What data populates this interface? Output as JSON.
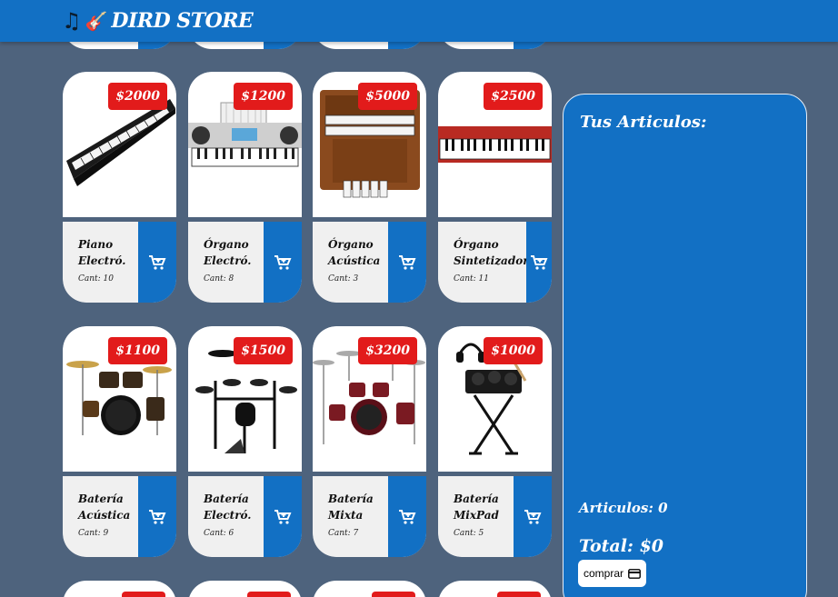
{
  "header": {
    "icon_note": "♫",
    "icon_guitar": "🎸",
    "title": "DIRD STORE"
  },
  "products": [
    {
      "price": "$2000",
      "name": "Piano Electró.",
      "qty": "Cant: 10",
      "image": "digital-piano"
    },
    {
      "price": "$1200",
      "name": "Órgano Electró.",
      "qty": "Cant: 8",
      "image": "electronic-keyboard"
    },
    {
      "price": "$5000",
      "name": "Órgano Acústica",
      "qty": "Cant: 3",
      "image": "wooden-organ"
    },
    {
      "price": "$2500",
      "name": "Órgano Sintetizador",
      "qty": "Cant: 11",
      "image": "red-synthesizer"
    },
    {
      "price": "$1100",
      "name": "Batería Acústica",
      "qty": "Cant: 9",
      "image": "acoustic-drum-kit"
    },
    {
      "price": "$1500",
      "name": "Batería Electró.",
      "qty": "Cant: 6",
      "image": "electronic-drum-kit"
    },
    {
      "price": "$3200",
      "name": "Batería Mixta",
      "qty": "Cant: 7",
      "image": "mixed-drum-kit"
    },
    {
      "price": "$1000",
      "name": "Batería MixPad",
      "qty": "Cant: 5",
      "image": "drum-pad-stand"
    }
  ],
  "cart": {
    "heading": "Tus Articulos:",
    "count_label": "Articulos: 0",
    "total_label": "Total: $0",
    "buy_label": "comprar"
  },
  "colors": {
    "background": "#4e637d",
    "header": "#1270c4",
    "price_badge": "#e21b1b",
    "card_info": "#f0f0f0"
  }
}
